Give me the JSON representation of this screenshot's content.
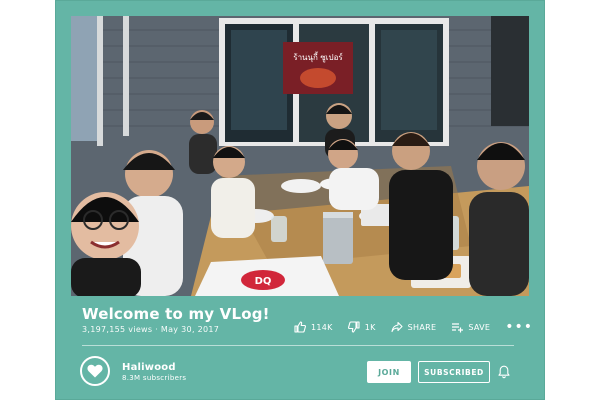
{
  "video": {
    "title": "Welcome to my VLog!",
    "views": "3,197,155 views",
    "date": "May 30, 2017",
    "meta_separator": " · ",
    "thumbnail_icon": "group-selfie-photo",
    "sign_text": "ร้านนุกี้ ซูเปอร์",
    "cup_logo_text": "DQ"
  },
  "actions": {
    "like": {
      "label": "114K",
      "icon": "thumbs-up-icon"
    },
    "dislike": {
      "label": "1K",
      "icon": "thumbs-down-icon"
    },
    "share": {
      "label": "SHARE",
      "icon": "share-icon"
    },
    "save": {
      "label": "SAVE",
      "icon": "playlist-add-icon"
    },
    "more": {
      "label": "•••",
      "icon": "more-icon"
    }
  },
  "channel": {
    "name": "Haliwood",
    "subscribers": "8.3M subscribers",
    "avatar_icon": "heart-icon",
    "join_label": "JOIN",
    "subscribe_label": "SUBSCRIBED",
    "bell_icon": "bell-icon"
  },
  "colors": {
    "card_background": "#64b5a6",
    "accent": "#5aa999",
    "text": "#ffffff"
  }
}
